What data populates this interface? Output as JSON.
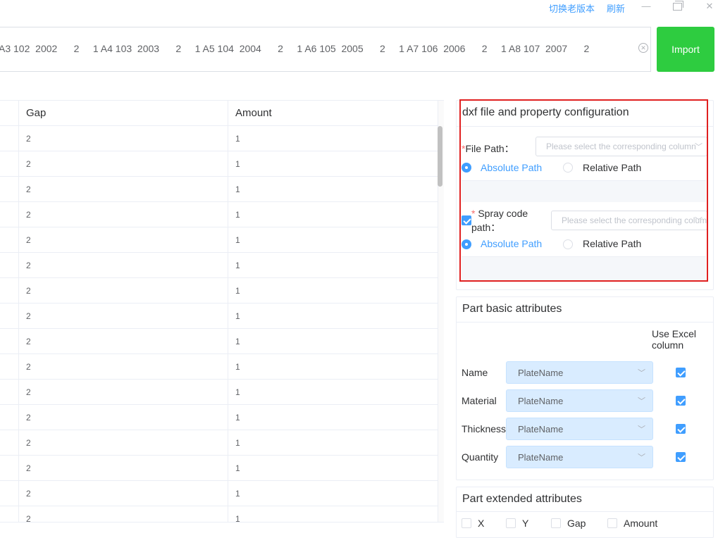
{
  "topbar": {
    "switch_old_version": "切换老版本",
    "refresh": "刷新",
    "minimize_glyph": "—",
    "close_glyph": "✕"
  },
  "input": {
    "value": "A3 102  2002      2     1 A4 103  2003      2     1 A5 104  2004      2     1 A6 105  2005      2     1 A7 106  2006      2     1 A8 107  2007      2"
  },
  "import_button": "Import",
  "grid": {
    "columns": [
      "Gap",
      "Amount"
    ],
    "rows": [
      [
        "2",
        "1"
      ],
      [
        "2",
        "1"
      ],
      [
        "2",
        "1"
      ],
      [
        "2",
        "1"
      ],
      [
        "2",
        "1"
      ],
      [
        "2",
        "1"
      ],
      [
        "2",
        "1"
      ],
      [
        "2",
        "1"
      ],
      [
        "2",
        "1"
      ],
      [
        "2",
        "1"
      ],
      [
        "2",
        "1"
      ],
      [
        "2",
        "1"
      ],
      [
        "2",
        "1"
      ],
      [
        "2",
        "1"
      ],
      [
        "2",
        "1"
      ],
      [
        "2",
        "1"
      ]
    ]
  },
  "dxf_panel": {
    "title": "dxf file and property configuration",
    "file_path": {
      "required_mark": "*",
      "label": "File Path：",
      "placeholder": "Please select the corresponding column",
      "absolute": "Absolute Path",
      "relative": "Relative Path",
      "selected": "absolute"
    },
    "spray_path": {
      "enabled": true,
      "required_mark": "*",
      "label_line1": "Spray code",
      "label_line2": "path：",
      "placeholder": "Please select the corresponding column",
      "absolute": "Absolute Path",
      "relative": "Relative Path",
      "selected": "absolute"
    }
  },
  "basic_panel": {
    "title": "Part basic attributes",
    "use_excel_line1": "Use Excel",
    "use_excel_line2": "column",
    "rows": [
      {
        "label": "Name",
        "value": "PlateName",
        "checked": true
      },
      {
        "label": "Material",
        "value": "PlateName",
        "checked": true
      },
      {
        "label": "Thickness",
        "value": "PlateName",
        "checked": true
      },
      {
        "label": "Quantity",
        "value": "PlateName",
        "checked": true
      }
    ]
  },
  "extended_panel": {
    "title": "Part extended attributes",
    "options": [
      {
        "label": "X",
        "checked": false
      },
      {
        "label": "Y",
        "checked": false
      },
      {
        "label": "Gap",
        "checked": false
      },
      {
        "label": "Amount",
        "checked": false
      }
    ]
  },
  "colors": {
    "primary": "#409eff",
    "import_green": "#2ecc40",
    "highlight_red": "#e02020",
    "select_bg": "#d9ecff"
  }
}
